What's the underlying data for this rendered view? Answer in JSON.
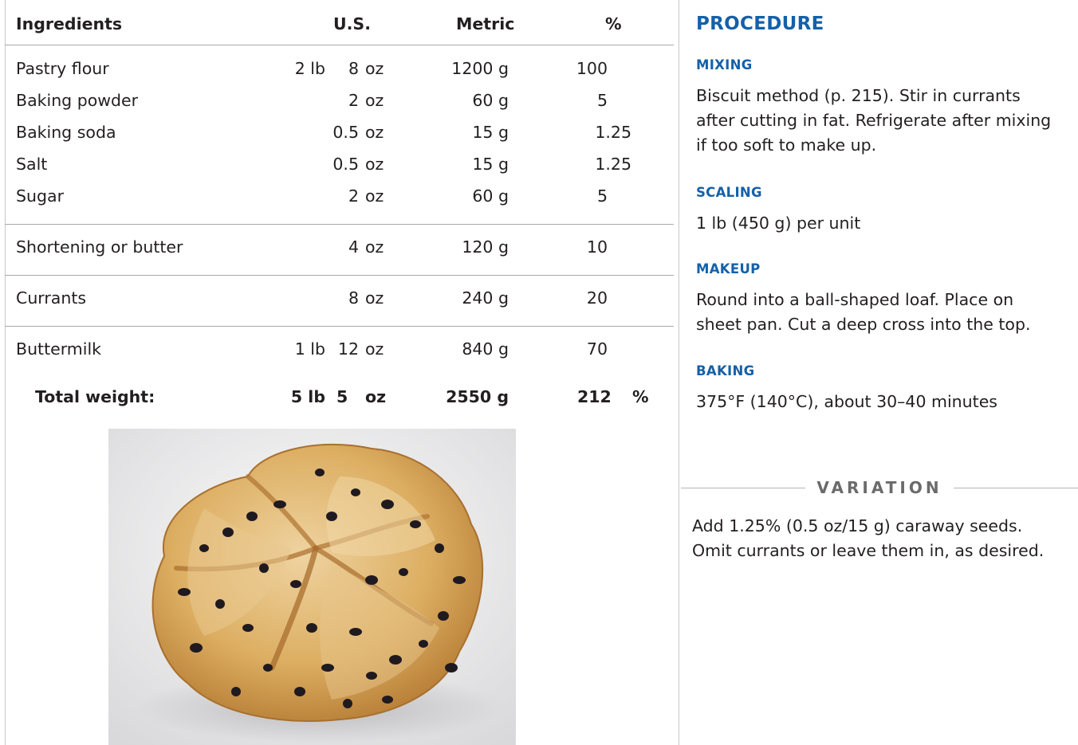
{
  "table": {
    "headers": {
      "ingredients": "Ingredients",
      "us": "U.S.",
      "metric": "Metric",
      "percent": "%"
    },
    "groups": [
      [
        {
          "name": "Pastry flour",
          "lb": "2 lb",
          "qty": "8",
          "unit": "oz",
          "metric": "1200 g",
          "percent": "100"
        },
        {
          "name": "Baking powder",
          "lb": "",
          "qty": "2",
          "unit": "oz",
          "metric": "60 g",
          "percent": "5"
        },
        {
          "name": "Baking soda",
          "lb": "",
          "qty": "0.5",
          "unit": "oz",
          "metric": "15 g",
          "percent": "1.25"
        },
        {
          "name": "Salt",
          "lb": "",
          "qty": "0.5",
          "unit": "oz",
          "metric": "15 g",
          "percent": "1.25"
        },
        {
          "name": "Sugar",
          "lb": "",
          "qty": "2",
          "unit": "oz",
          "metric": "60 g",
          "percent": "5"
        }
      ],
      [
        {
          "name": "Shortening or butter",
          "lb": "",
          "qty": "4",
          "unit": "oz",
          "metric": "120 g",
          "percent": "10"
        }
      ],
      [
        {
          "name": "Currants",
          "lb": "",
          "qty": "8",
          "unit": "oz",
          "metric": "240 g",
          "percent": "20"
        }
      ],
      [
        {
          "name": "Buttermilk",
          "lb": "1 lb",
          "qty": "12",
          "unit": "oz",
          "metric": "840 g",
          "percent": "70"
        }
      ]
    ],
    "total": {
      "label": "Total weight:",
      "lb": "5 lb",
      "qty": "5",
      "unit": "oz",
      "metric": "2550 g",
      "percent": "212",
      "percent_sign": "%"
    }
  },
  "procedure": {
    "title": "PROCEDURE",
    "sections": [
      {
        "heading": "MIXING",
        "text": "Biscuit method (p. 215). Stir in currants after cutting in fat. Refrigerate after mixing if too soft to make up."
      },
      {
        "heading": "SCALING",
        "text": "1 lb (450 g) per unit"
      },
      {
        "heading": "MAKEUP",
        "text": "Round into a ball-shaped loaf. Place on sheet pan. Cut a deep cross into the top."
      },
      {
        "heading": "BAKING",
        "text": "375°F (140°C), about 30–40 minutes"
      }
    ]
  },
  "variation": {
    "heading": "VARIATION",
    "text": "Add 1.25% (0.5 oz/15 g) caraway seeds. Omit currants or leave them in, as desired."
  },
  "photo": {
    "currant_color": "#1f1a20",
    "crust_color": "#d8a95a"
  }
}
